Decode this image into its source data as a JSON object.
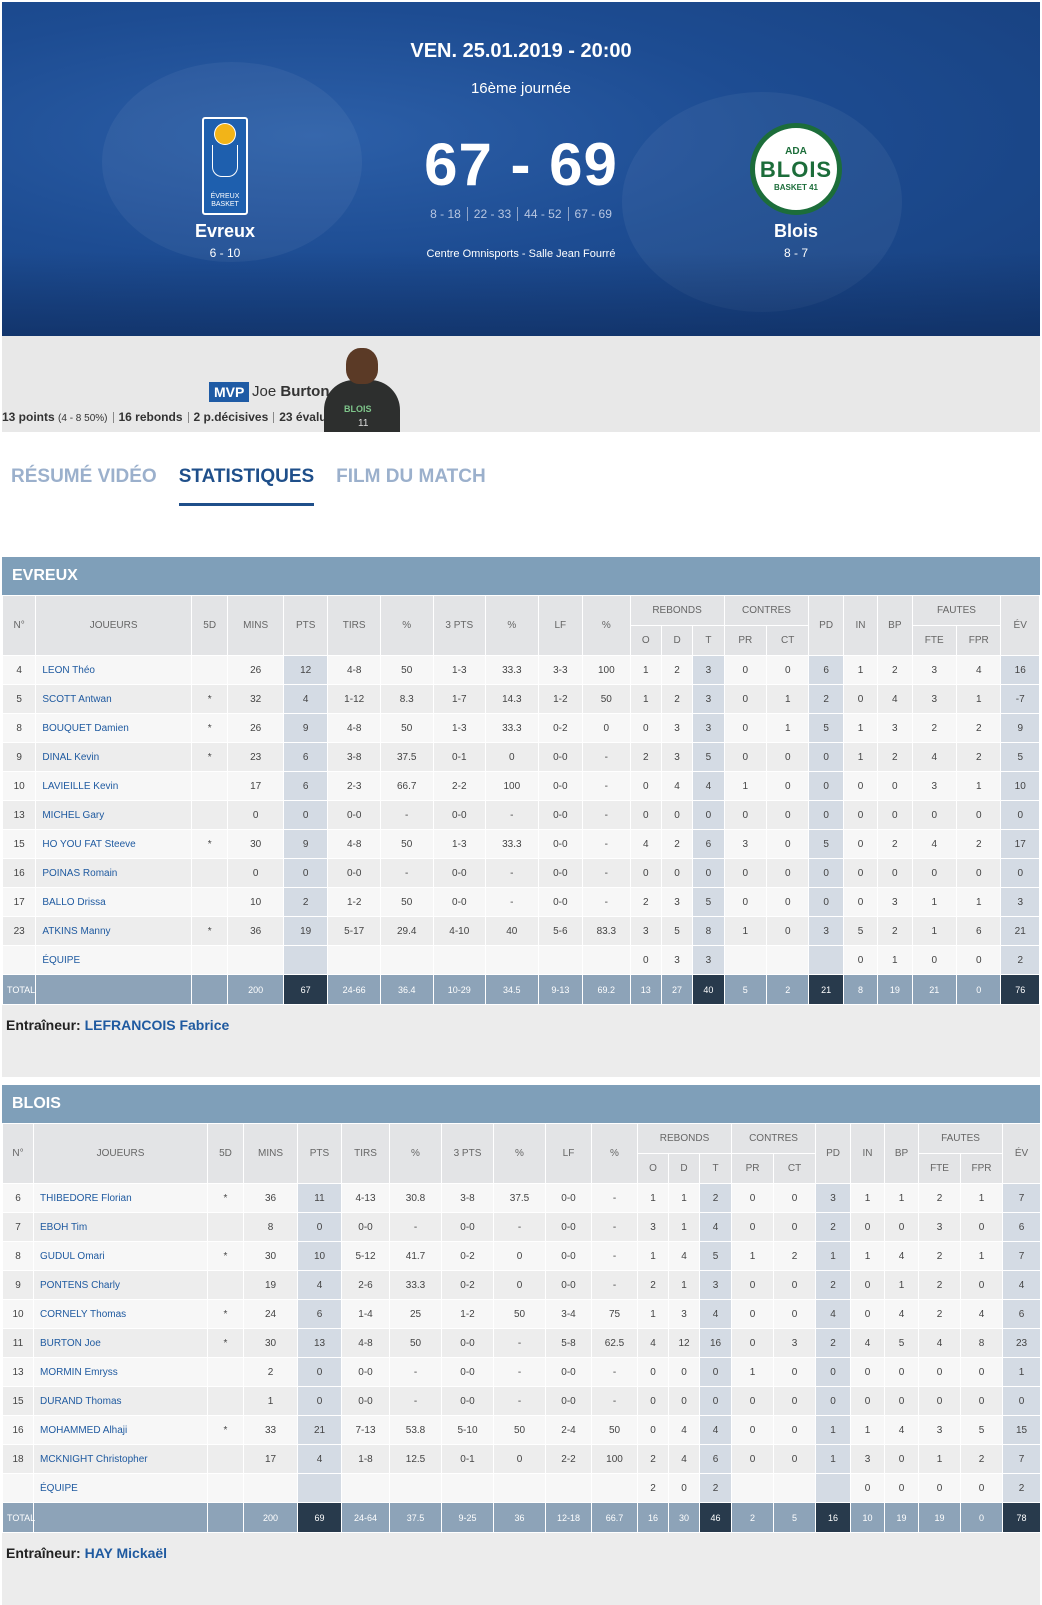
{
  "header": {
    "date": "VEN. 25.01.2019 - 20:00",
    "round": "16ème journée",
    "score": "67 - 69",
    "quarters": [
      "8 - 18",
      "22 - 33",
      "44 - 52",
      "67 - 69"
    ],
    "venue": "Centre Omnisports - Salle Jean Fourré",
    "home": {
      "name": "Evreux",
      "record": "6 - 10",
      "logo_text": "ÉVREUX BASKET"
    },
    "away": {
      "name": "Blois",
      "record": "8 - 7",
      "logo_top": "ADA",
      "logo_mid": "BLOIS",
      "logo_bot": "BASKET 41"
    }
  },
  "mvp": {
    "badge": "MVP",
    "first": "Joe",
    "last": "Burton",
    "points": "13 points",
    "shooting": "(4 - 8 50%)",
    "rebounds": "16 rebonds",
    "assists": "2 p.décisives",
    "eval": "23 évaluation",
    "jersey_text": "BLOIS",
    "jersey_num": "11"
  },
  "tabs": [
    {
      "label": "RÉSUMÉ VIDÉO",
      "active": false
    },
    {
      "label": "STATISTIQUES",
      "active": true
    },
    {
      "label": "FILM DU MATCH",
      "active": false
    }
  ],
  "columns": {
    "num": "N°",
    "players": "JOUEURS",
    "five": "5D",
    "mins": "MINS",
    "pts": "PTS",
    "tirs": "TIRS",
    "pct": "%",
    "three": "3 PTS",
    "lf": "LF",
    "rebonds": "REBONDS",
    "o": "O",
    "d": "D",
    "t": "T",
    "contres": "CONTRES",
    "pr": "PR",
    "ct": "CT",
    "pd": "PD",
    "in": "IN",
    "bp": "BP",
    "fautes": "FAUTES",
    "fte": "FTE",
    "fpr": "FPR",
    "ev": "ÉV"
  },
  "teams": [
    {
      "title": "EVREUX",
      "coach_label": "Entraîneur:",
      "coach": "LEFRANCOIS Fabrice",
      "rows": [
        [
          "4",
          "LEON Théo",
          "",
          "26",
          "12",
          "4-8",
          "50",
          "1-3",
          "33.3",
          "3-3",
          "100",
          "1",
          "2",
          "3",
          "0",
          "0",
          "6",
          "1",
          "2",
          "3",
          "4",
          "16"
        ],
        [
          "5",
          "SCOTT Antwan",
          "*",
          "32",
          "4",
          "1-12",
          "8.3",
          "1-7",
          "14.3",
          "1-2",
          "50",
          "1",
          "2",
          "3",
          "0",
          "1",
          "2",
          "0",
          "4",
          "3",
          "1",
          "-7"
        ],
        [
          "8",
          "BOUQUET Damien",
          "*",
          "26",
          "9",
          "4-8",
          "50",
          "1-3",
          "33.3",
          "0-2",
          "0",
          "0",
          "3",
          "3",
          "0",
          "1",
          "5",
          "1",
          "3",
          "2",
          "2",
          "9"
        ],
        [
          "9",
          "DINAL Kevin",
          "*",
          "23",
          "6",
          "3-8",
          "37.5",
          "0-1",
          "0",
          "0-0",
          "-",
          "2",
          "3",
          "5",
          "0",
          "0",
          "0",
          "1",
          "2",
          "4",
          "2",
          "5"
        ],
        [
          "10",
          "LAVIEILLE Kevin",
          "",
          "17",
          "6",
          "2-3",
          "66.7",
          "2-2",
          "100",
          "0-0",
          "-",
          "0",
          "4",
          "4",
          "1",
          "0",
          "0",
          "0",
          "0",
          "3",
          "1",
          "10"
        ],
        [
          "13",
          "MICHEL Gary",
          "",
          "0",
          "0",
          "0-0",
          "-",
          "0-0",
          "-",
          "0-0",
          "-",
          "0",
          "0",
          "0",
          "0",
          "0",
          "0",
          "0",
          "0",
          "0",
          "0",
          "0"
        ],
        [
          "15",
          "HO YOU FAT Steeve",
          "*",
          "30",
          "9",
          "4-8",
          "50",
          "1-3",
          "33.3",
          "0-0",
          "-",
          "4",
          "2",
          "6",
          "3",
          "0",
          "5",
          "0",
          "2",
          "4",
          "2",
          "17"
        ],
        [
          "16",
          "POINAS Romain",
          "",
          "0",
          "0",
          "0-0",
          "-",
          "0-0",
          "-",
          "0-0",
          "-",
          "0",
          "0",
          "0",
          "0",
          "0",
          "0",
          "0",
          "0",
          "0",
          "0",
          "0"
        ],
        [
          "17",
          "BALLO Drissa",
          "",
          "10",
          "2",
          "1-2",
          "50",
          "0-0",
          "-",
          "0-0",
          "-",
          "2",
          "3",
          "5",
          "0",
          "0",
          "0",
          "0",
          "3",
          "1",
          "1",
          "3"
        ],
        [
          "23",
          "ATKINS Manny",
          "*",
          "36",
          "19",
          "5-17",
          "29.4",
          "4-10",
          "40",
          "5-6",
          "83.3",
          "3",
          "5",
          "8",
          "1",
          "0",
          "3",
          "5",
          "2",
          "1",
          "6",
          "21"
        ],
        [
          "",
          "ÉQUIPE",
          "",
          "",
          "",
          "",
          "",
          "",
          "",
          "",
          "",
          "0",
          "3",
          "3",
          "",
          "",
          "",
          "0",
          "1",
          "0",
          "0",
          "2"
        ]
      ],
      "total": [
        "TOTAL",
        "",
        "",
        "200",
        "67",
        "24-66",
        "36.4",
        "10-29",
        "34.5",
        "9-13",
        "69.2",
        "13",
        "27",
        "40",
        "5",
        "2",
        "21",
        "8",
        "19",
        "21",
        "0",
        "76"
      ]
    },
    {
      "title": "BLOIS",
      "coach_label": "Entraîneur:",
      "coach": "HAY Mickaël",
      "rows": [
        [
          "6",
          "THIBEDORE Florian",
          "*",
          "36",
          "11",
          "4-13",
          "30.8",
          "3-8",
          "37.5",
          "0-0",
          "-",
          "1",
          "1",
          "2",
          "0",
          "0",
          "3",
          "1",
          "1",
          "2",
          "1",
          "7"
        ],
        [
          "7",
          "EBOH Tim",
          "",
          "8",
          "0",
          "0-0",
          "-",
          "0-0",
          "-",
          "0-0",
          "-",
          "3",
          "1",
          "4",
          "0",
          "0",
          "2",
          "0",
          "0",
          "3",
          "0",
          "6"
        ],
        [
          "8",
          "GUDUL Omari",
          "*",
          "30",
          "10",
          "5-12",
          "41.7",
          "0-2",
          "0",
          "0-0",
          "-",
          "1",
          "4",
          "5",
          "1",
          "2",
          "1",
          "1",
          "4",
          "2",
          "1",
          "7"
        ],
        [
          "9",
          "PONTENS Charly",
          "",
          "19",
          "4",
          "2-6",
          "33.3",
          "0-2",
          "0",
          "0-0",
          "-",
          "2",
          "1",
          "3",
          "0",
          "0",
          "2",
          "0",
          "1",
          "2",
          "0",
          "4"
        ],
        [
          "10",
          "CORNELY Thomas",
          "*",
          "24",
          "6",
          "1-4",
          "25",
          "1-2",
          "50",
          "3-4",
          "75",
          "1",
          "3",
          "4",
          "0",
          "0",
          "4",
          "0",
          "4",
          "2",
          "4",
          "6"
        ],
        [
          "11",
          "BURTON Joe",
          "*",
          "30",
          "13",
          "4-8",
          "50",
          "0-0",
          "-",
          "5-8",
          "62.5",
          "4",
          "12",
          "16",
          "0",
          "3",
          "2",
          "4",
          "5",
          "4",
          "8",
          "23"
        ],
        [
          "13",
          "MORMIN Emryss",
          "",
          "2",
          "0",
          "0-0",
          "-",
          "0-0",
          "-",
          "0-0",
          "-",
          "0",
          "0",
          "0",
          "1",
          "0",
          "0",
          "0",
          "0",
          "0",
          "0",
          "1"
        ],
        [
          "15",
          "DURAND Thomas",
          "",
          "1",
          "0",
          "0-0",
          "-",
          "0-0",
          "-",
          "0-0",
          "-",
          "0",
          "0",
          "0",
          "0",
          "0",
          "0",
          "0",
          "0",
          "0",
          "0",
          "0"
        ],
        [
          "16",
          "MOHAMMED Alhaji",
          "*",
          "33",
          "21",
          "7-13",
          "53.8",
          "5-10",
          "50",
          "2-4",
          "50",
          "0",
          "4",
          "4",
          "0",
          "0",
          "1",
          "1",
          "4",
          "3",
          "5",
          "15"
        ],
        [
          "18",
          "MCKNIGHT Christopher",
          "",
          "17",
          "4",
          "1-8",
          "12.5",
          "0-1",
          "0",
          "2-2",
          "100",
          "2",
          "4",
          "6",
          "0",
          "0",
          "1",
          "3",
          "0",
          "1",
          "2",
          "7"
        ],
        [
          "",
          "ÉQUIPE",
          "",
          "",
          "",
          "",
          "",
          "",
          "",
          "",
          "",
          "2",
          "0",
          "2",
          "",
          "",
          "",
          "0",
          "0",
          "0",
          "0",
          "2"
        ]
      ],
      "total": [
        "TOTAL",
        "",
        "",
        "200",
        "69",
        "24-64",
        "37.5",
        "9-25",
        "36",
        "12-18",
        "66.7",
        "16",
        "30",
        "46",
        "2",
        "5",
        "16",
        "10",
        "19",
        "19",
        "0",
        "78"
      ]
    }
  ],
  "colors": {
    "hero": "#1d4c92",
    "section_header": "#7f9fb9",
    "total_row": "#8da3b8",
    "highlight": "#283a4c",
    "link": "#1f5aa0"
  }
}
